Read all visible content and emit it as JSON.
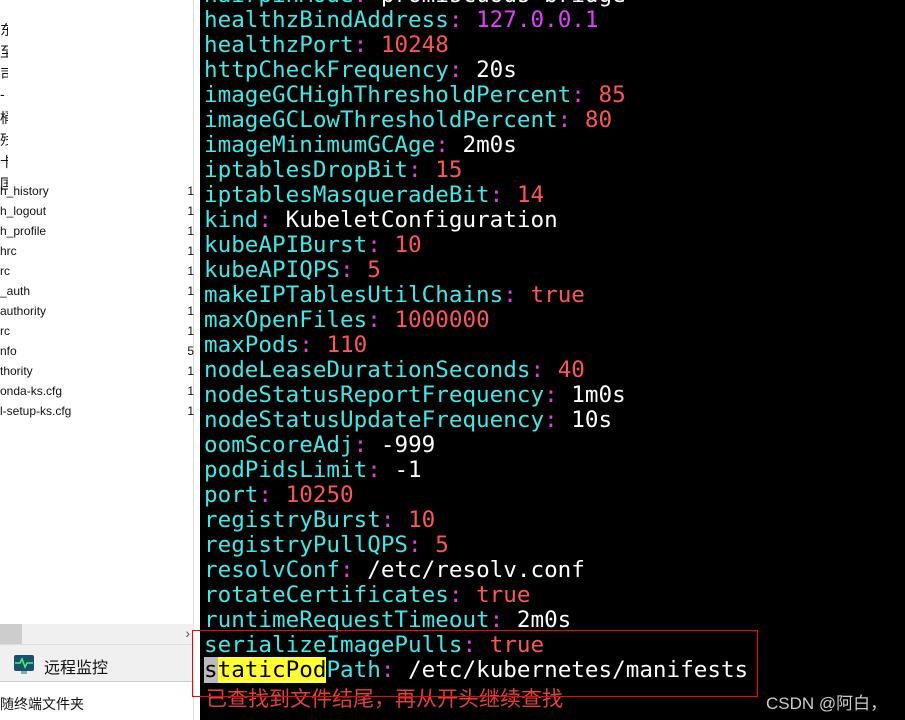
{
  "sidebar": {
    "cn_fragments": [
      "东",
      "至",
      "司",
      "-",
      "桶",
      "残",
      "卡",
      "国"
    ],
    "files": [
      {
        "name": "h_history",
        "size": "1"
      },
      {
        "name": "h_logout",
        "size": "1"
      },
      {
        "name": "h_profile",
        "size": "1"
      },
      {
        "name": "hrc",
        "size": "1"
      },
      {
        "name": "rc",
        "size": "1"
      },
      {
        "name": "_auth",
        "size": "1"
      },
      {
        "name": "authority",
        "size": "1"
      },
      {
        "name": "rc",
        "size": "1"
      },
      {
        "name": "nfo",
        "size": "5"
      },
      {
        "name": "thority",
        "size": "1"
      },
      {
        "name": "onda-ks.cfg",
        "size": "1"
      },
      {
        "name": "l-setup-ks.cfg",
        "size": "1"
      }
    ],
    "scroll_arrow": "›",
    "remote_monitor": "远程监控",
    "follow_terminal": "随终端文件夹"
  },
  "terminal": {
    "lines": [
      {
        "key": "hairpinMode",
        "value": "promiscuous-bridge",
        "type": "str"
      },
      {
        "key": "healthzBindAddress",
        "value": "127.0.0.1",
        "type": "ip"
      },
      {
        "key": "healthzPort",
        "value": "10248",
        "type": "num"
      },
      {
        "key": "httpCheckFrequency",
        "value": "20s",
        "type": "str"
      },
      {
        "key": "imageGCHighThresholdPercent",
        "value": "85",
        "type": "num"
      },
      {
        "key": "imageGCLowThresholdPercent",
        "value": "80",
        "type": "num"
      },
      {
        "key": "imageMinimumGCAge",
        "value": "2m0s",
        "type": "str"
      },
      {
        "key": "iptablesDropBit",
        "value": "15",
        "type": "num"
      },
      {
        "key": "iptablesMasqueradeBit",
        "value": "14",
        "type": "num"
      },
      {
        "key": "kind",
        "value": "KubeletConfiguration",
        "type": "str"
      },
      {
        "key": "kubeAPIBurst",
        "value": "10",
        "type": "num"
      },
      {
        "key": "kubeAPIQPS",
        "value": "5",
        "type": "num"
      },
      {
        "key": "makeIPTablesUtilChains",
        "value": "true",
        "type": "num"
      },
      {
        "key": "maxOpenFiles",
        "value": "1000000",
        "type": "num"
      },
      {
        "key": "maxPods",
        "value": "110",
        "type": "num"
      },
      {
        "key": "nodeLeaseDurationSeconds",
        "value": "40",
        "type": "num"
      },
      {
        "key": "nodeStatusReportFrequency",
        "value": "1m0s",
        "type": "str"
      },
      {
        "key": "nodeStatusUpdateFrequency",
        "value": "10s",
        "type": "str"
      },
      {
        "key": "oomScoreAdj",
        "value": "-999",
        "type": "str"
      },
      {
        "key": "podPidsLimit",
        "value": "-1",
        "type": "str"
      },
      {
        "key": "port",
        "value": "10250",
        "type": "num"
      },
      {
        "key": "registryBurst",
        "value": "10",
        "type": "num"
      },
      {
        "key": "registryPullQPS",
        "value": "5",
        "type": "num"
      },
      {
        "key": "resolvConf",
        "value": "/etc/resolv.conf",
        "type": "str"
      },
      {
        "key": "rotateCertificates",
        "value": "true",
        "type": "num"
      },
      {
        "key": "runtimeRequestTimeout",
        "value": "2m0s",
        "type": "str"
      },
      {
        "key": "serializeImagePulls",
        "value": "true",
        "type": "num"
      }
    ],
    "last_line": {
      "cursor": "s",
      "match": "taticPod",
      "rest": "Path",
      "value": "/etc/kubernetes/manifests"
    },
    "search_message": "已查找到文件结尾，再从开头继续查找"
  },
  "watermark": "CSDN @阿白，",
  "colors": {
    "key": "#40e8e8",
    "colon": "#e040e0",
    "number": "#ff5555",
    "highlight": "#ffff33",
    "message": "#e04040",
    "annotation_box": "#ff0000"
  }
}
